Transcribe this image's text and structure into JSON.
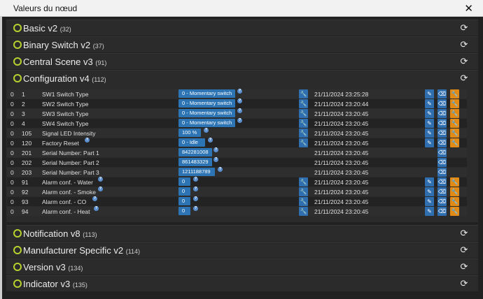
{
  "window": {
    "title": "Valeurs du nœud",
    "close_glyph": "✕"
  },
  "colors": {
    "status_ring": "#b7d12e",
    "value_button": "#2c74b3",
    "action_button": "#2f6fb0",
    "config_button": "#e28a16"
  },
  "icons": {
    "refresh": "refresh-icon",
    "wrench": "wrench-icon",
    "pencil": "pencil-icon",
    "eraser": "eraser-icon",
    "status": "status-ring-icon",
    "help": "help-icon"
  },
  "sections": [
    {
      "name": "Basic v2",
      "count": "(32)"
    },
    {
      "name": "Binary Switch v2",
      "count": "(37)"
    },
    {
      "name": "Central Scene v3",
      "count": "(91)"
    },
    {
      "name": "Configuration v4",
      "count": "(112)"
    },
    {
      "name": "Notification v8",
      "count": "(113)"
    },
    {
      "name": "Manufacturer Specific v2",
      "count": "(114)"
    },
    {
      "name": "Version v3",
      "count": "(134)"
    },
    {
      "name": "Indicator v3",
      "count": "(135)"
    }
  ],
  "config_rows": [
    {
      "ep": "0",
      "id": "1",
      "label": "SW1 Switch Type",
      "value": "0 - Momentary switch",
      "help": true,
      "time": "21/11/2024 23:25:28",
      "set": true,
      "edit": true
    },
    {
      "ep": "0",
      "id": "2",
      "label": "SW2 Switch Type",
      "value": "0 - Momentary switch",
      "help": true,
      "time": "21/11/2024 23:20:44",
      "set": true,
      "edit": true
    },
    {
      "ep": "0",
      "id": "3",
      "label": "SW3 Switch Type",
      "value": "0 - Momentary switch",
      "help": true,
      "time": "21/11/2024 23:20:45",
      "set": true,
      "edit": true
    },
    {
      "ep": "0",
      "id": "4",
      "label": "SW4 Switch Type",
      "value": "0 - Momentary switch",
      "help": true,
      "time": "21/11/2024 23:20:45",
      "set": true,
      "edit": true
    },
    {
      "ep": "0",
      "id": "105",
      "label": "Signal LED Intensity",
      "value": "100 %",
      "help": true,
      "time": "21/11/2024 23:20:45",
      "set": true,
      "edit": true
    },
    {
      "ep": "0",
      "id": "120",
      "label": "Factory Reset",
      "value": "0 - Idle",
      "help": true,
      "label_help": true,
      "time": "21/11/2024 23:20:45",
      "set": true,
      "edit": true
    },
    {
      "ep": "0",
      "id": "201",
      "label": "Serial Number: Part 1",
      "value": "842281008",
      "help": true,
      "time": "21/11/2024 23:20:45",
      "set": false,
      "edit": false
    },
    {
      "ep": "0",
      "id": "202",
      "label": "Serial Number: Part 2",
      "value": "861483329",
      "help": true,
      "time": "21/11/2024 23:20:45",
      "set": false,
      "edit": false
    },
    {
      "ep": "0",
      "id": "203",
      "label": "Serial Number: Part 3",
      "value": "1211188789",
      "help": true,
      "time": "21/11/2024 23:20:45",
      "set": false,
      "edit": false
    },
    {
      "ep": "0",
      "id": "91",
      "label": "Alarm conf. - Water",
      "value": "0",
      "help": true,
      "label_help": true,
      "time": "21/11/2024 23:20:45",
      "set": true,
      "edit": true
    },
    {
      "ep": "0",
      "id": "92",
      "label": "Alarm conf. - Smoke",
      "value": "0",
      "help": true,
      "label_help": true,
      "time": "21/11/2024 23:20:45",
      "set": true,
      "edit": true
    },
    {
      "ep": "0",
      "id": "93",
      "label": "Alarm conf. - CO",
      "value": "0",
      "help": true,
      "label_help": true,
      "time": "21/11/2024 23:20:45",
      "set": true,
      "edit": true
    },
    {
      "ep": "0",
      "id": "94",
      "label": "Alarm conf. - Heat",
      "value": "0",
      "help": true,
      "label_help": true,
      "time": "21/11/2024 23:20:45",
      "set": true,
      "edit": true
    }
  ],
  "glyphs": {
    "refresh": "⟳",
    "wrench": "🔧",
    "pencil": "✎",
    "eraser": "⌫",
    "help": "?"
  }
}
